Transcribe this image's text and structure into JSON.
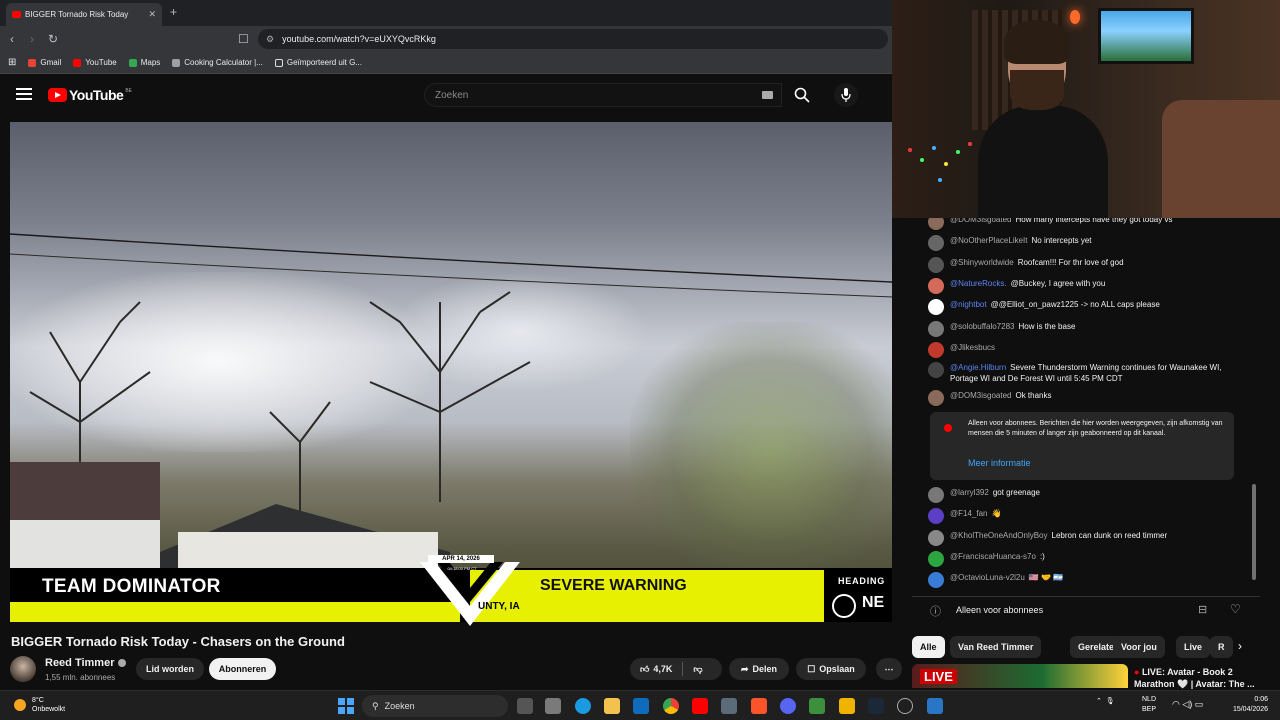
{
  "browser": {
    "tab_title": "BIGGER Tornado Risk Today",
    "url": "youtube.com/watch?v=eUXYQvcRKkg",
    "bookmarks": [
      "Gmail",
      "YouTube",
      "Maps",
      "Cooking Calculator |...",
      "Geïmporteerd uit G..."
    ]
  },
  "youtube": {
    "logo_text": "YouTube",
    "country_code": "BE",
    "search_placeholder": "Zoeken"
  },
  "video": {
    "overlay": {
      "team": "TEAM DOMINATOR",
      "warning": "SEVERE WARNING",
      "date": "APR 14, 2026",
      "time": "04:18:00 PM CT",
      "county": "UNTY, IA",
      "heading_label": "HEADING",
      "heading_value": "NE"
    },
    "title": "BIGGER Tornado Risk Today - Chasers on the Ground",
    "channel": "Reed Timmer",
    "subscribers": "1,55 mln. abonnees",
    "join_label": "Lid worden",
    "subscribe_label": "Abonneren",
    "likes": "4,7K",
    "share_label": "Delen",
    "save_label": "Opslaan"
  },
  "chat": {
    "messages": [
      {
        "user": "@DOM3isgoated",
        "text": "How many intercepts have they got today vs",
        "type": "member",
        "color": "#8a6a5a"
      },
      {
        "user": "@NoOtherPlaceLikeIt",
        "text": "No intercepts yet",
        "type": "normal",
        "color": "#666666"
      },
      {
        "user": "@Shinyworldwide",
        "text": "Roofcam!!! For thr love of god",
        "type": "normal",
        "color": "#555555"
      },
      {
        "user": "@NatureRocks.",
        "text": "@Buckey, I agree with you",
        "type": "mod",
        "color": "#d46a5a"
      },
      {
        "user": "@nightbot",
        "text": "@@Elliot_on_pawz1225 -> no ALL caps please",
        "type": "mod",
        "color": "#ffffff"
      },
      {
        "user": "@solobuffalo7283",
        "text": "How is the base",
        "type": "normal",
        "color": "#777777"
      },
      {
        "user": "@Jlikesbucs",
        "text": "",
        "type": "member",
        "color": "#c0392b"
      },
      {
        "user": "@Angie.Hilburn",
        "text": "Severe Thunderstorm Warning continues for Waunakee WI, Portage WI and De Forest WI until 5:45 PM CDT",
        "type": "mod",
        "color": "#444444"
      },
      {
        "user": "@DOM3isgoated",
        "text": "Ok thanks",
        "type": "member",
        "color": "#8a6a5a"
      },
      {
        "user": "@larryl392",
        "text": "got greenage",
        "type": "normal",
        "color": "#777777"
      },
      {
        "user": "@F14_fan",
        "text": "👋",
        "type": "normal",
        "color": "#5b3fc4"
      },
      {
        "user": "@KholTheOneAndOnlyBoy",
        "text": "Lebron can dunk on reed timmer",
        "type": "normal",
        "color": "#888888"
      },
      {
        "user": "@FranciscaHuanca-s7o",
        "text": ":)",
        "type": "normal",
        "color": "#2ba640"
      },
      {
        "user": "@OctavioLuna-v2l2u",
        "text": "🇺🇸 🤝 🇦🇷",
        "type": "normal",
        "color": "#3a7bd5"
      }
    ],
    "notice": "Alleen voor abonnees. Berichten die hier worden weergegeven, zijn afkomstig van mensen die 5 minuten of langer zijn geabonneerd op dit kanaal.",
    "notice_link": "Meer informatie",
    "footer": "Alleen voor abonnees"
  },
  "chips": [
    "Alle",
    "Van Reed Timmer",
    "Gerelateerd",
    "Voor jou",
    "Live",
    "R"
  ],
  "next_video": {
    "badge": "LIVE",
    "title": "LIVE: Avatar - Book 2 Marathon 🤍 | Avatar: The ..."
  },
  "taskbar": {
    "temperature": "8°C",
    "weather": "Onbewolkt",
    "search": "Zoeken",
    "lang1": "NLD",
    "lang2": "BEP",
    "time": "0:06",
    "date": "15/04/2026"
  }
}
